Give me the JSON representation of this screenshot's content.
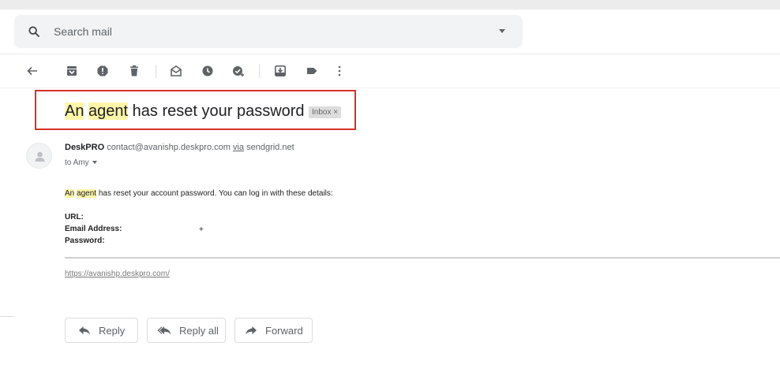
{
  "search": {
    "placeholder": "Search mail"
  },
  "toolbar": {
    "icons": [
      "back-arrow-icon",
      "archive-icon",
      "report-spam-icon",
      "delete-icon",
      "mark-unread-icon",
      "snooze-icon",
      "add-to-tasks-icon",
      "move-to-icon",
      "labels-icon",
      "more-icon"
    ]
  },
  "email": {
    "subject_part1": "An",
    "subject_part2": "agent",
    "subject_part3": "has reset your password",
    "label_badge": "Inbox ×",
    "sender_name": "DeskPRO",
    "sender_email": "contact@avanishp.deskpro.com",
    "via_label": "via",
    "via_domain": "sendgrid.net",
    "recipient": "to Amy",
    "body_hl1": "An",
    "body_hl2": "agent",
    "body_rest": "has reset your account password. You can log in with these details:",
    "url_label": "URL:",
    "email_label": "Email Address:",
    "email_plus": "+",
    "password_label": "Password:",
    "footer_link": "https://avanishp.deskpro.com/"
  },
  "actions": {
    "reply": "Reply",
    "reply_all": "Reply all",
    "forward": "Forward"
  },
  "colors": {
    "highlight": "#fff5a8",
    "annotation_box": "#d93025",
    "search_bg": "#f1f3f4"
  }
}
